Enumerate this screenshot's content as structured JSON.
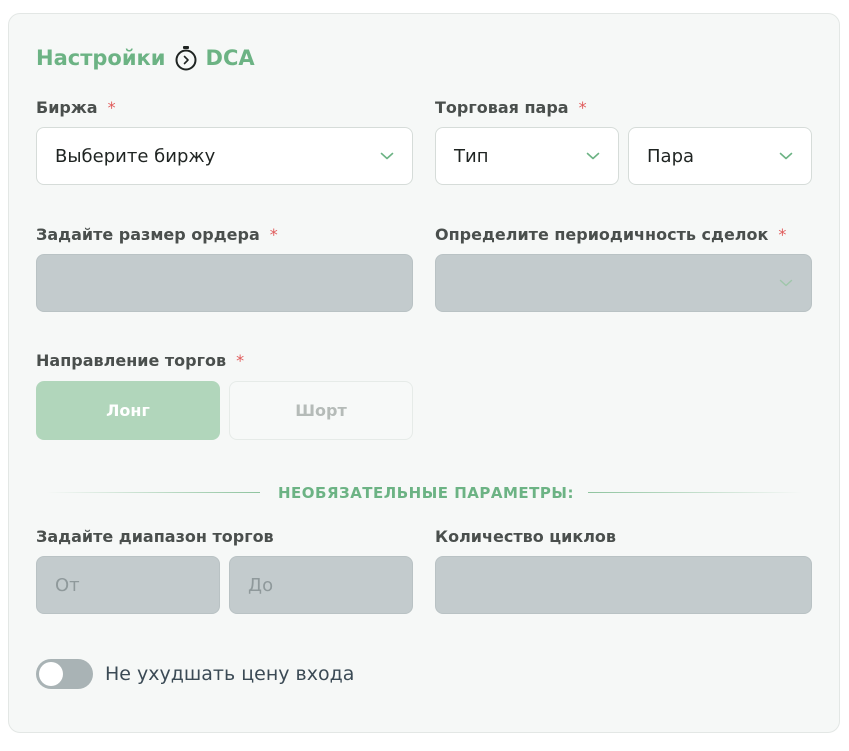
{
  "header": {
    "title": "Настройки",
    "title_suffix": "DCA"
  },
  "exchange": {
    "label": "Биржа",
    "required_mark": "*",
    "placeholder": "Выберите биржу"
  },
  "trading_pair": {
    "label": "Торговая пара",
    "required_mark": "*",
    "type_placeholder": "Тип",
    "pair_placeholder": "Пара"
  },
  "order_size": {
    "label": "Задайте размер ордера",
    "required_mark": "*"
  },
  "frequency": {
    "label": "Определите периодичность сделок",
    "required_mark": "*"
  },
  "direction": {
    "label": "Направление торгов",
    "required_mark": "*",
    "long_label": "Лонг",
    "short_label": "Шорт",
    "selected": "Лонг"
  },
  "optional": {
    "heading": "НЕОБЯЗАТЕЛЬНЫЕ ПАРАМЕТРЫ:"
  },
  "range": {
    "label": "Задайте диапазон торгов",
    "from_placeholder": "От",
    "to_placeholder": "До"
  },
  "cycles": {
    "label": "Количество циклов"
  },
  "no_worse_entry": {
    "label": "Не ухудшать цену входа",
    "enabled": false
  },
  "colors": {
    "accent": "#6cb384",
    "required": "#e05a5a",
    "disabled_field": "#c3cbcd",
    "selected_button": "#b1d6bb"
  },
  "icons": {
    "title_icon": "stopwatch-icon",
    "dropdown": "chevron-down-icon"
  }
}
